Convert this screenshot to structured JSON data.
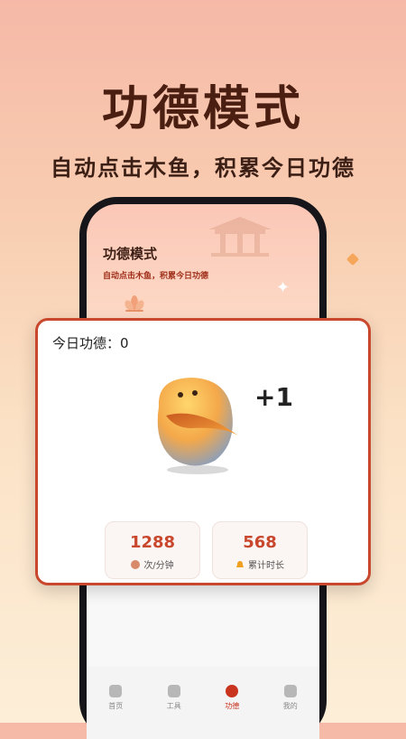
{
  "hero": {
    "title": "功德模式",
    "subtitle": "自动点击木鱼，积累今日功德"
  },
  "screen": {
    "title": "功德模式",
    "subtitle": "自动点击木鱼，积累今日功德"
  },
  "card": {
    "merit_label": "今日功德：0",
    "increment": "+1",
    "stats": [
      {
        "value": "1288",
        "label": "次/分钟",
        "icon": "wooden-fish-icon"
      },
      {
        "value": "568",
        "label": "累计时长",
        "icon": "bell-icon"
      }
    ]
  },
  "tabbar": {
    "items": [
      {
        "label": "首页",
        "icon": "home-icon",
        "active": false
      },
      {
        "label": "工具",
        "icon": "tools-icon",
        "active": false
      },
      {
        "label": "功德",
        "icon": "merit-icon",
        "active": true
      },
      {
        "label": "我的",
        "icon": "profile-icon",
        "active": false
      }
    ]
  },
  "colors": {
    "accent": "#c8472d",
    "title_dark": "#4a1f12"
  }
}
